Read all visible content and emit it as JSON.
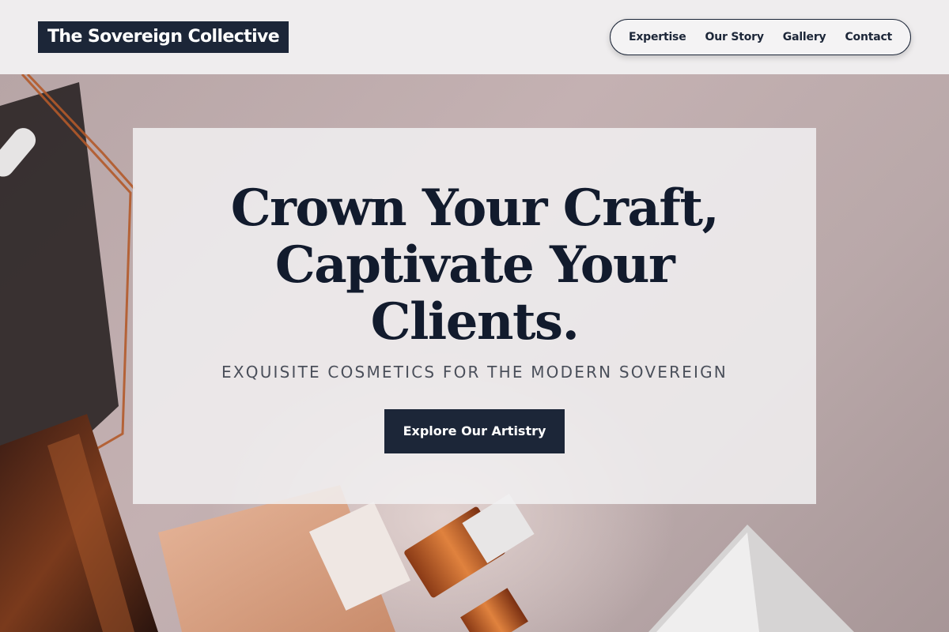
{
  "header": {
    "logo_text": "The Sovereign Collective",
    "nav": [
      "Expertise",
      "Our Story",
      "Gallery",
      "Contact"
    ]
  },
  "hero": {
    "headline_lines": [
      "Crown Your Craft,",
      "Captivate Your",
      "Clients."
    ],
    "tagline": "EXQUISITE COSMETICS FOR THE MODERN SOVEREIGN",
    "cta_label": "Explore Our Artistry"
  },
  "colors": {
    "brand_navy": "#1c2638",
    "headline": "#121b2d",
    "header_bg": "#efedee",
    "copper_accent": "#b35a2a"
  }
}
